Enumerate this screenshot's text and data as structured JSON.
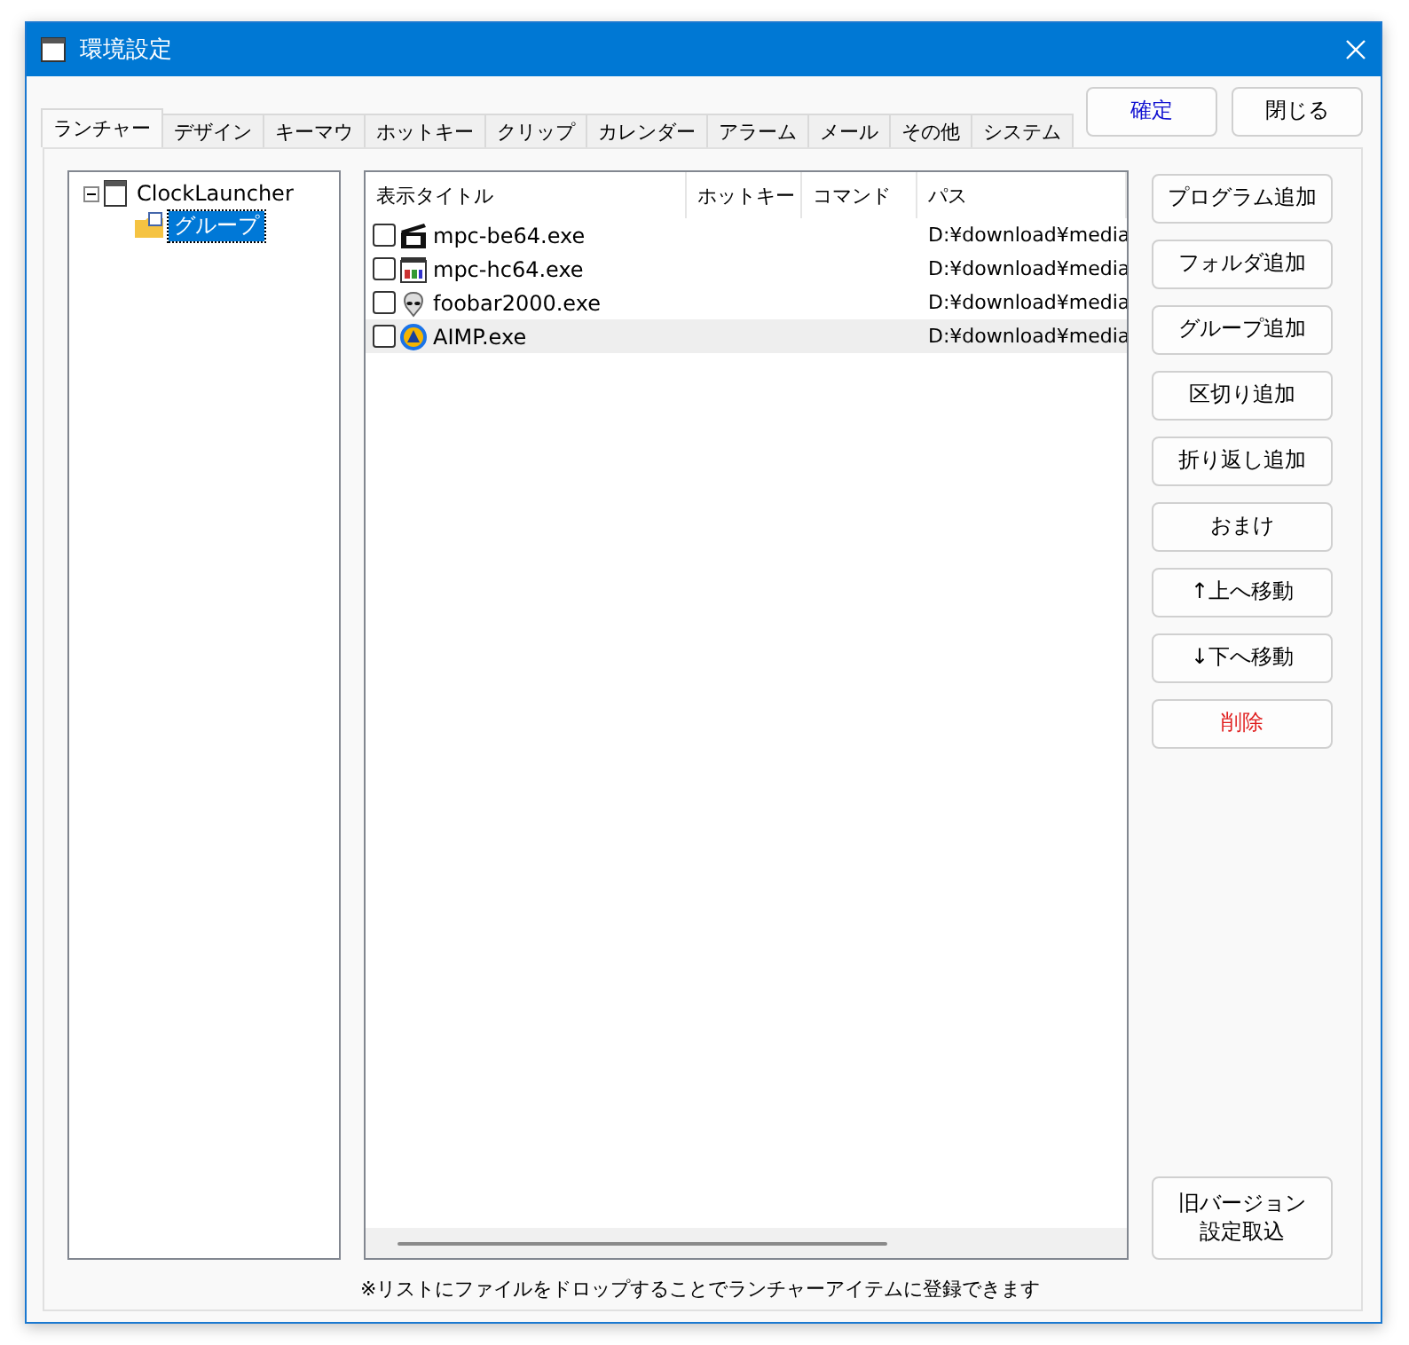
{
  "window": {
    "title": "環境設定"
  },
  "tabs": [
    {
      "label": "ランチャー",
      "selected": true
    },
    {
      "label": "デザイン",
      "selected": false
    },
    {
      "label": "キーマウ",
      "selected": false
    },
    {
      "label": "ホットキー",
      "selected": false
    },
    {
      "label": "クリップ",
      "selected": false
    },
    {
      "label": "カレンダー",
      "selected": false
    },
    {
      "label": "アラーム",
      "selected": false
    },
    {
      "label": "メール",
      "selected": false
    },
    {
      "label": "その他",
      "selected": false
    },
    {
      "label": "システム",
      "selected": false
    }
  ],
  "top_buttons": [
    {
      "label": "確定",
      "kind": "primary"
    },
    {
      "label": "閉じる",
      "kind": "normal"
    }
  ],
  "tree": [
    {
      "label": "ClockLauncher",
      "kind": "app",
      "expanded": true,
      "selected": false,
      "children": [
        {
          "label": "グループ",
          "kind": "group",
          "selected": true
        }
      ]
    }
  ],
  "table": {
    "columns": [
      "表示タイトル",
      "ホットキー",
      "コマンド",
      "パス"
    ],
    "rows": [
      {
        "title": "mpc-be64.exe",
        "path": "D:¥download¥media",
        "checked": false,
        "selected": false
      },
      {
        "title": "mpc-hc64.exe",
        "path": "D:¥download¥media",
        "checked": false,
        "selected": false
      },
      {
        "title": "foobar2000.exe",
        "path": "D:¥download¥media",
        "checked": false,
        "selected": false
      },
      {
        "title": "AIMP.exe",
        "path": "D:¥download¥media",
        "checked": false,
        "selected": true
      }
    ]
  },
  "side_buttons": [
    {
      "label": "プログラム追加",
      "kind": "normal"
    },
    {
      "label": "フォルダ追加",
      "kind": "normal"
    },
    {
      "label": "グループ追加",
      "kind": "normal"
    },
    {
      "label": "区切り追加",
      "kind": "normal"
    },
    {
      "label": "折り返し追加",
      "kind": "normal"
    },
    {
      "label": "おまけ",
      "kind": "normal"
    },
    {
      "label": "↑上へ移動",
      "kind": "normal"
    },
    {
      "label": "↓下へ移動",
      "kind": "normal"
    },
    {
      "label": "削除",
      "kind": "danger"
    }
  ],
  "legacy_button": {
    "lines": [
      "旧バージョン",
      "設定取込"
    ]
  },
  "note": "※リストにファイルをドロップすることでランチャーアイテムに登録できます"
}
